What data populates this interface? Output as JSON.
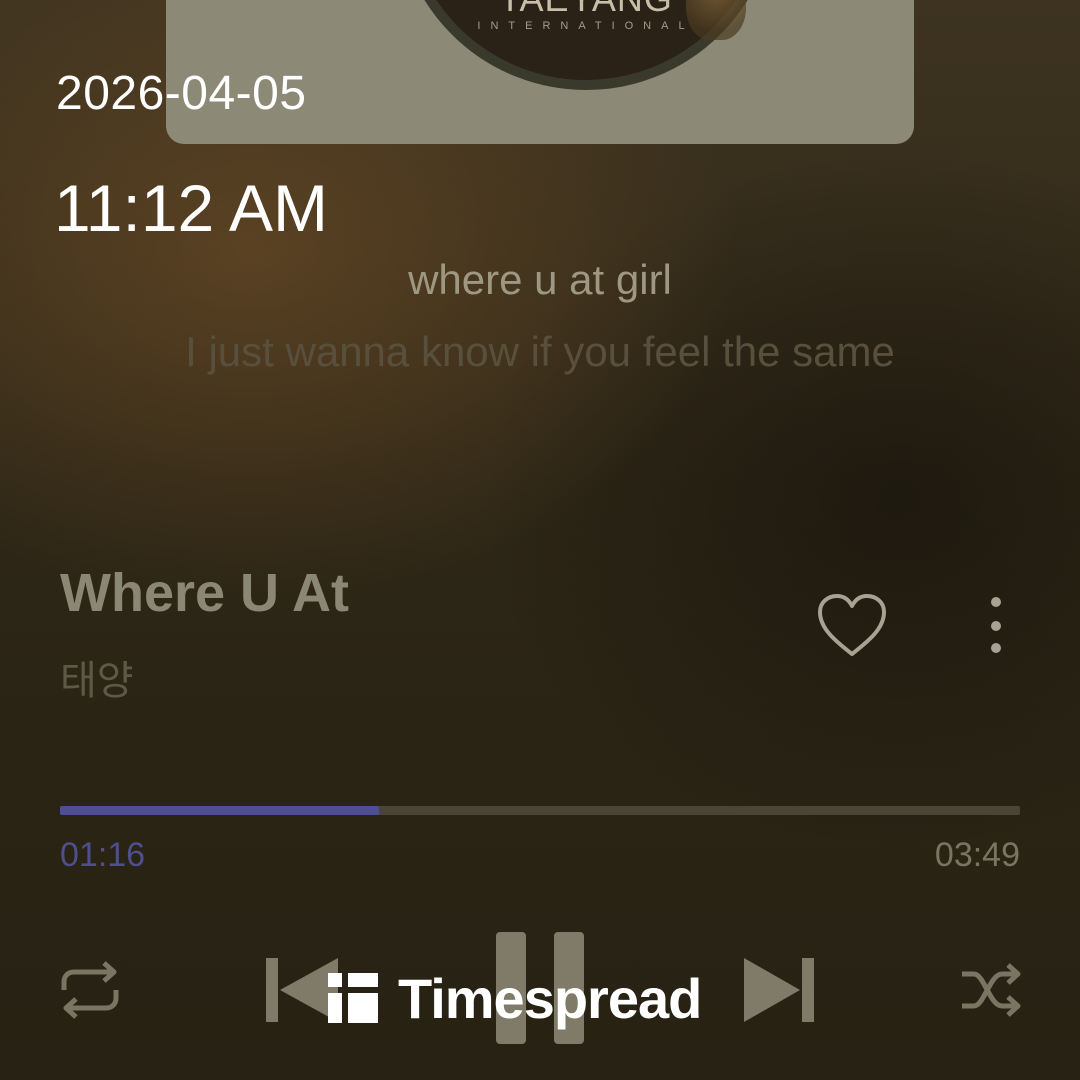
{
  "status": {
    "date": "2026-04-05",
    "time": "11:12 AM"
  },
  "album_art": {
    "brand": "TAEYANG",
    "brand_sub": "INTERNATIONAL"
  },
  "lyrics": {
    "current": "where u at girl",
    "next": "I just wanna know if you feel the same"
  },
  "track": {
    "title": "Where U At",
    "artist": "태양"
  },
  "playback": {
    "elapsed": "01:16",
    "total": "03:49",
    "progress_fraction": 0.332,
    "state": "playing"
  },
  "controls": {
    "repeat_icon": "repeat-icon",
    "prev_icon": "skip-previous-icon",
    "pause_icon": "pause-icon",
    "next_icon": "skip-next-icon",
    "shuffle_icon": "shuffle-icon",
    "like_icon": "heart-icon",
    "more_icon": "more-vertical-icon"
  },
  "watermark": {
    "text": "Timespread"
  },
  "colors": {
    "progress_fill": "#4e4f92",
    "elapsed_text": "#4e4f8c",
    "background": "#2e2717"
  }
}
